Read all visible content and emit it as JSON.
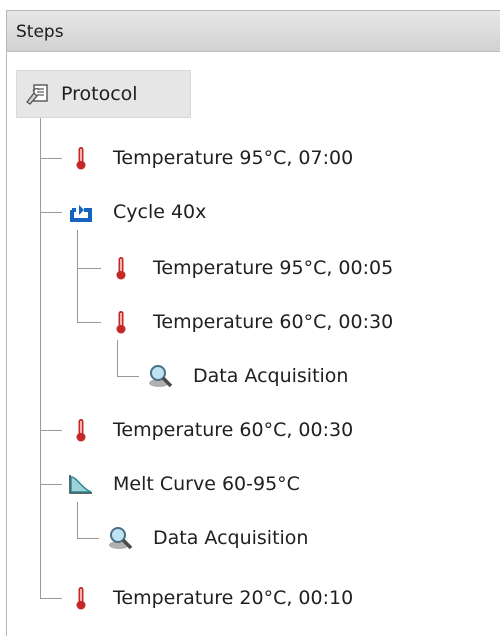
{
  "panel": {
    "title": "Steps"
  },
  "tree": {
    "root": {
      "label": "Protocol",
      "icon": "protocol-icon"
    },
    "nodes": [
      {
        "label": "Temperature 95°C, 07:00",
        "icon": "thermometer-icon"
      },
      {
        "label": "Cycle 40x",
        "icon": "cycle-icon"
      },
      {
        "label": "Temperature 95°C, 00:05",
        "icon": "thermometer-icon"
      },
      {
        "label": "Temperature 60°C, 00:30",
        "icon": "thermometer-icon"
      },
      {
        "label": "Data Acquisition",
        "icon": "data-acquisition-icon"
      },
      {
        "label": "Temperature 60°C, 00:30",
        "icon": "thermometer-icon"
      },
      {
        "label": "Melt Curve 60-95°C",
        "icon": "melt-curve-icon"
      },
      {
        "label": "Data Acquisition",
        "icon": "data-acquisition-icon"
      },
      {
        "label": "Temperature 20°C, 00:10",
        "icon": "thermometer-icon"
      }
    ]
  }
}
